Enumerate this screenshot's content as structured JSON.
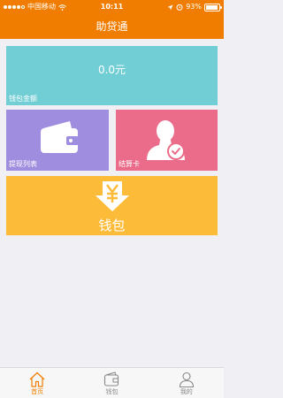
{
  "status_bar": {
    "carrier": "中国移动",
    "time": "10:11",
    "battery": "93%",
    "battery_level": 0.93
  },
  "nav": {
    "title": "助贷通"
  },
  "balance": {
    "amount": "0.0元",
    "caption": "钱包金额"
  },
  "withdraw": {
    "caption": "提现列表",
    "icon": "wallet-icon"
  },
  "card": {
    "caption": "结算卡",
    "icon": "user-check-icon"
  },
  "wallet": {
    "label": "钱包",
    "icon": "yen-download-icon"
  },
  "colors": {
    "accent": "#f07d00",
    "balance_tile": "#71ced5",
    "withdraw_tile": "#9f8ddf",
    "card_tile": "#ea6c8a",
    "wallet_tile": "#fdbb3a"
  },
  "tabs": [
    {
      "label": "首页",
      "icon": "home-icon",
      "active": true
    },
    {
      "label": "钱包",
      "icon": "wallet-icon",
      "active": false
    },
    {
      "label": "我的",
      "icon": "user-icon",
      "active": false
    }
  ]
}
